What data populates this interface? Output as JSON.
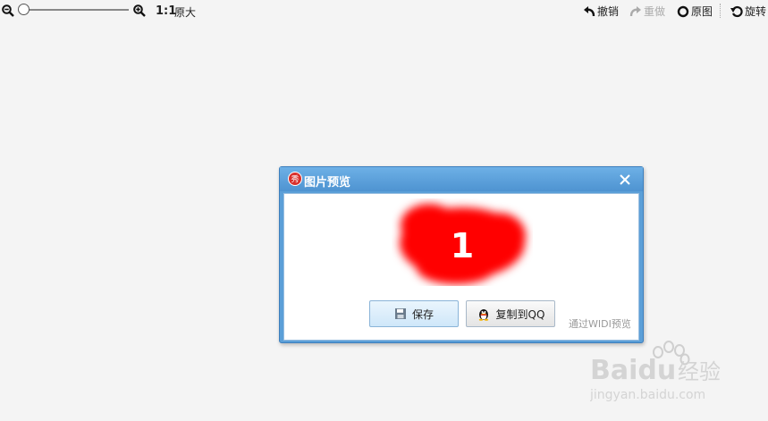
{
  "toolbar": {
    "zoom_out_icon": "zoom-out-icon",
    "zoom_in_icon": "zoom-in-icon",
    "zoom_level": 0,
    "ratio": "1:1",
    "original_size": "原大",
    "undo": "撤销",
    "redo": "重做",
    "original": "原图",
    "rotate": "旋转"
  },
  "dialog": {
    "title": "图片预览",
    "preview_number": "1",
    "save_label": "保存",
    "copy_qq_label": "复制到QQ",
    "widi_note": "通过WIDI预览"
  },
  "watermark": {
    "brand": "Baidu",
    "brand_cn": "经验",
    "url": "jingyan.baidu.com"
  },
  "colors": {
    "background": "#f4f4f4",
    "dialog_blue": "#5b9fd8",
    "preview_red": "#ff0000"
  }
}
